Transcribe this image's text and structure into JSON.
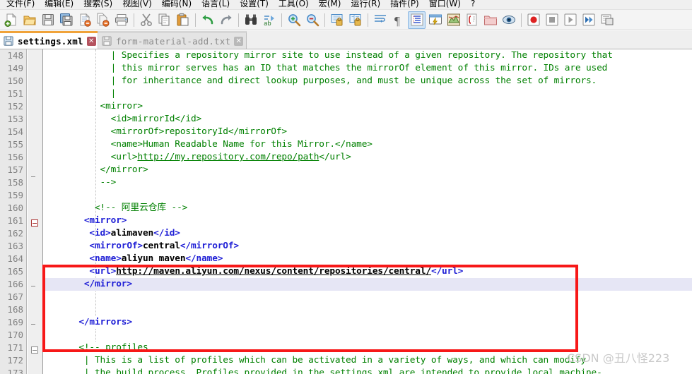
{
  "app": {
    "name": "Notepad++"
  },
  "menubar": {
    "items": [
      {
        "label": "文件(F)",
        "name": "menu-file"
      },
      {
        "label": "编辑(E)",
        "name": "menu-edit"
      },
      {
        "label": "搜索(S)",
        "name": "menu-search"
      },
      {
        "label": "视图(V)",
        "name": "menu-view"
      },
      {
        "label": "编码(N)",
        "name": "menu-encoding"
      },
      {
        "label": "语言(L)",
        "name": "menu-language"
      },
      {
        "label": "设置(T)",
        "name": "menu-settings"
      },
      {
        "label": "工具(O)",
        "name": "menu-tools"
      },
      {
        "label": "宏(M)",
        "name": "menu-macro"
      },
      {
        "label": "运行(R)",
        "name": "menu-run"
      },
      {
        "label": "插件(P)",
        "name": "menu-plugins"
      },
      {
        "label": "窗口(W)",
        "name": "menu-window"
      },
      {
        "label": "?",
        "name": "menu-help"
      }
    ]
  },
  "toolbar": {
    "buttons": [
      {
        "icon": "new-file-icon",
        "name": "toolbar-new"
      },
      {
        "icon": "open-folder-icon",
        "name": "toolbar-open"
      },
      {
        "icon": "save-icon",
        "name": "toolbar-save"
      },
      {
        "icon": "save-all-icon",
        "name": "toolbar-save-all"
      },
      {
        "icon": "close-file-icon",
        "name": "toolbar-close"
      },
      {
        "icon": "close-all-icon",
        "name": "toolbar-close-all"
      },
      {
        "icon": "print-icon",
        "name": "toolbar-print"
      },
      {
        "icon": "separator",
        "name": "toolbar-sep-1"
      },
      {
        "icon": "cut-scissors-icon",
        "name": "toolbar-cut"
      },
      {
        "icon": "copy-icon",
        "name": "toolbar-copy"
      },
      {
        "icon": "paste-clipboard-icon",
        "name": "toolbar-paste"
      },
      {
        "icon": "separator",
        "name": "toolbar-sep-2"
      },
      {
        "icon": "undo-arrow-icon",
        "name": "toolbar-undo"
      },
      {
        "icon": "redo-arrow-icon",
        "name": "toolbar-redo"
      },
      {
        "icon": "separator",
        "name": "toolbar-sep-3"
      },
      {
        "icon": "find-binoculars-icon",
        "name": "toolbar-find"
      },
      {
        "icon": "replace-icon",
        "name": "toolbar-replace"
      },
      {
        "icon": "separator",
        "name": "toolbar-sep-4"
      },
      {
        "icon": "zoom-in-icon",
        "name": "toolbar-zoom-in"
      },
      {
        "icon": "zoom-out-icon",
        "name": "toolbar-zoom-out"
      },
      {
        "icon": "separator",
        "name": "toolbar-sep-5"
      },
      {
        "icon": "sync-vertical-icon",
        "name": "toolbar-sync-vertical"
      },
      {
        "icon": "sync-horizontal-icon",
        "name": "toolbar-sync-horizontal"
      },
      {
        "icon": "separator",
        "name": "toolbar-sep-6"
      },
      {
        "icon": "word-wrap-icon",
        "name": "toolbar-word-wrap"
      },
      {
        "icon": "pilcrow-icon",
        "name": "toolbar-show-symbols"
      },
      {
        "icon": "indent-guide-icon",
        "name": "toolbar-indent-guide"
      },
      {
        "icon": "user-define-icon",
        "name": "toolbar-user-define-dialog"
      },
      {
        "icon": "doc-map-icon",
        "name": "toolbar-document-map"
      },
      {
        "icon": "function-list-icon",
        "name": "toolbar-function-list"
      },
      {
        "icon": "folder-workspace-icon",
        "name": "toolbar-folder-workspace"
      },
      {
        "icon": "monitor-eye-icon",
        "name": "toolbar-monitoring"
      },
      {
        "icon": "separator",
        "name": "toolbar-sep-7"
      },
      {
        "icon": "record-macro-icon",
        "name": "toolbar-record-macro"
      },
      {
        "icon": "stop-macro-icon",
        "name": "toolbar-stop-macro"
      },
      {
        "icon": "play-macro-icon",
        "name": "toolbar-play-macro"
      },
      {
        "icon": "run-multi-macro-icon",
        "name": "toolbar-run-multi-macro"
      },
      {
        "icon": "save-macro-icon",
        "name": "toolbar-save-macro"
      }
    ]
  },
  "tabs": [
    {
      "label": "settings.xml",
      "active": true,
      "close": "✕"
    },
    {
      "label": "form-material-add.txt",
      "active": false,
      "close": "✕"
    }
  ],
  "editor": {
    "first_line": 148,
    "highlight_line": 166,
    "lines": [
      {
        "n": 148,
        "segments": [
          {
            "t": "            | Specifies a repository mirror site to use instead of a given repository. The repository that",
            "c": "cmt"
          }
        ]
      },
      {
        "n": 149,
        "segments": [
          {
            "t": "            | this mirror serves has an ID that matches the mirrorOf element of this mirror. IDs are used",
            "c": "cmt"
          }
        ]
      },
      {
        "n": 150,
        "segments": [
          {
            "t": "            | for inheritance and direct lookup purposes, and must be unique across the set of mirrors.",
            "c": "cmt"
          }
        ]
      },
      {
        "n": 151,
        "segments": [
          {
            "t": "            |",
            "c": "cmt"
          }
        ]
      },
      {
        "n": 152,
        "segments": [
          {
            "t": "          <mirror>",
            "c": "cmt"
          }
        ]
      },
      {
        "n": 153,
        "segments": [
          {
            "t": "            <id>mirrorId</id>",
            "c": "cmt"
          }
        ]
      },
      {
        "n": 154,
        "segments": [
          {
            "t": "            <mirrorOf>repositoryId</mirrorOf>",
            "c": "cmt"
          }
        ]
      },
      {
        "n": 155,
        "segments": [
          {
            "t": "            <name>Human Readable Name for this Mirror.</name>",
            "c": "cmt"
          }
        ]
      },
      {
        "n": 156,
        "segments": [
          {
            "t": "            <url>",
            "c": "cmt"
          },
          {
            "t": "http://my.repository.com/repo/path",
            "c": "clink"
          },
          {
            "t": "</url>",
            "c": "cmt"
          }
        ]
      },
      {
        "n": 157,
        "segments": [
          {
            "t": "          </mirror>",
            "c": "cmt"
          }
        ]
      },
      {
        "n": 158,
        "segments": [
          {
            "t": "          -->",
            "c": "cmt"
          }
        ]
      },
      {
        "n": 159,
        "segments": [
          {
            "t": "",
            "c": "cmt"
          }
        ]
      },
      {
        "n": 160,
        "segments": [
          {
            "t": "         <!-- 阿里云仓库 -->",
            "c": "cmt"
          }
        ]
      },
      {
        "n": 161,
        "segments": [
          {
            "t": "       <mirror>",
            "c": "tag"
          }
        ]
      },
      {
        "n": 162,
        "segments": [
          {
            "t": "        <id>",
            "c": "tag"
          },
          {
            "t": "alimaven",
            "c": "txt"
          },
          {
            "t": "</id>",
            "c": "tag"
          }
        ]
      },
      {
        "n": 163,
        "segments": [
          {
            "t": "        <mirrorOf>",
            "c": "tag"
          },
          {
            "t": "central",
            "c": "txt"
          },
          {
            "t": "</mirrorOf>",
            "c": "tag"
          }
        ]
      },
      {
        "n": 164,
        "segments": [
          {
            "t": "        <name>",
            "c": "tag"
          },
          {
            "t": "aliyun maven",
            "c": "txt"
          },
          {
            "t": "</name>",
            "c": "tag"
          }
        ]
      },
      {
        "n": 165,
        "segments": [
          {
            "t": "        <url>",
            "c": "tag"
          },
          {
            "t": "http://maven.aliyun.com/nexus/content/repositories/central/",
            "c": "link"
          },
          {
            "t": "</url>",
            "c": "tag"
          }
        ]
      },
      {
        "n": 166,
        "segments": [
          {
            "t": "       </mirror>",
            "c": "tag"
          }
        ]
      },
      {
        "n": 167,
        "segments": [
          {
            "t": "",
            "c": "tag"
          }
        ]
      },
      {
        "n": 168,
        "segments": [
          {
            "t": "",
            "c": "tag"
          }
        ]
      },
      {
        "n": 169,
        "segments": [
          {
            "t": "      </mirrors>",
            "c": "tag"
          }
        ]
      },
      {
        "n": 170,
        "segments": [
          {
            "t": "",
            "c": "tag"
          }
        ]
      },
      {
        "n": 171,
        "segments": [
          {
            "t": "      <!-- profiles",
            "c": "cmt"
          }
        ]
      },
      {
        "n": 172,
        "segments": [
          {
            "t": "       | This is a list of profiles which can be activated in a variety of ways, and which can modify",
            "c": "cmt"
          }
        ]
      },
      {
        "n": 173,
        "segments": [
          {
            "t": "       | the build process. Profiles provided in the settings.xml are intended to provide local machine-",
            "c": "cmt"
          }
        ]
      }
    ]
  },
  "annotation": {
    "color": "#f71818",
    "name": "red-highlight-rectangle"
  },
  "watermark": {
    "text": "CSDN @丑八怪223"
  }
}
